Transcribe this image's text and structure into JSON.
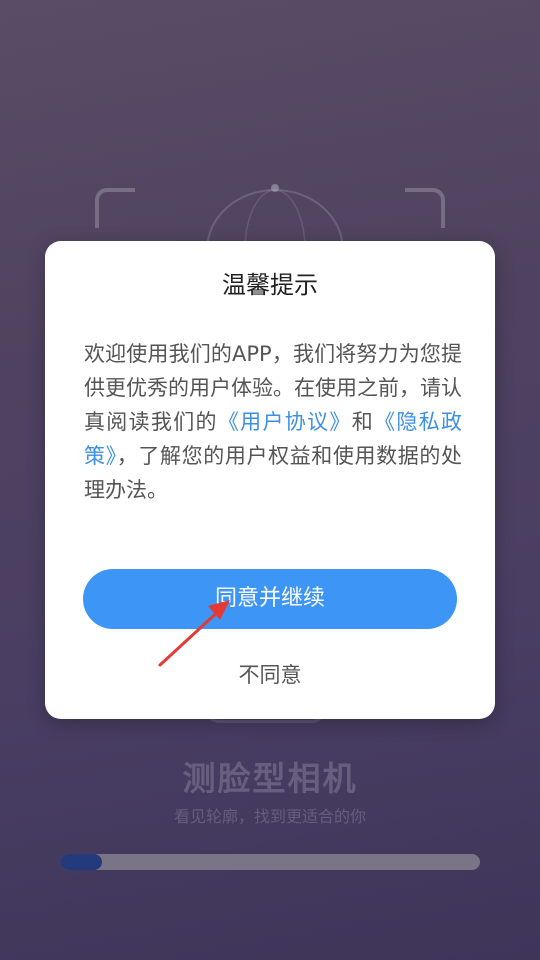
{
  "app": {
    "title": "测脸型相机",
    "subtitle": "看见轮廓，找到更适合的你",
    "progress": 0.1
  },
  "dialog": {
    "title": "温馨提示",
    "body": {
      "part1": "欢迎使用我们的APP，我们将努力为您提供更优秀的用户体验。在使用之前，请认真阅读我们的",
      "link_user_agreement": "《用户协议》",
      "part2": "和",
      "link_privacy_policy": "《隐私政策》",
      "part3": "，了解您的用户权益和使用数据的处理办法。"
    },
    "agree_label": "同意并继续",
    "disagree_label": "不同意"
  },
  "colors": {
    "accent": "#3d95f6",
    "link": "#3d8fe6",
    "annotation": "#e53935"
  }
}
